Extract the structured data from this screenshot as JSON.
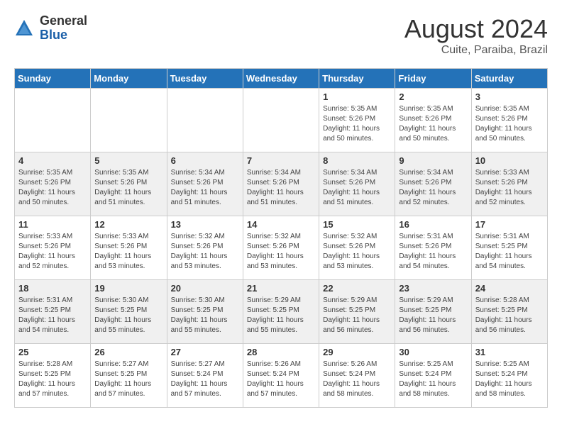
{
  "header": {
    "logo_general": "General",
    "logo_blue": "Blue",
    "month": "August 2024",
    "location": "Cuite, Paraiba, Brazil"
  },
  "weekdays": [
    "Sunday",
    "Monday",
    "Tuesday",
    "Wednesday",
    "Thursday",
    "Friday",
    "Saturday"
  ],
  "weeks": [
    [
      {
        "day": "",
        "info": ""
      },
      {
        "day": "",
        "info": ""
      },
      {
        "day": "",
        "info": ""
      },
      {
        "day": "",
        "info": ""
      },
      {
        "day": "1",
        "info": "Sunrise: 5:35 AM\nSunset: 5:26 PM\nDaylight: 11 hours and 50 minutes."
      },
      {
        "day": "2",
        "info": "Sunrise: 5:35 AM\nSunset: 5:26 PM\nDaylight: 11 hours and 50 minutes."
      },
      {
        "day": "3",
        "info": "Sunrise: 5:35 AM\nSunset: 5:26 PM\nDaylight: 11 hours and 50 minutes."
      }
    ],
    [
      {
        "day": "4",
        "info": "Sunrise: 5:35 AM\nSunset: 5:26 PM\nDaylight: 11 hours and 50 minutes."
      },
      {
        "day": "5",
        "info": "Sunrise: 5:35 AM\nSunset: 5:26 PM\nDaylight: 11 hours and 51 minutes."
      },
      {
        "day": "6",
        "info": "Sunrise: 5:34 AM\nSunset: 5:26 PM\nDaylight: 11 hours and 51 minutes."
      },
      {
        "day": "7",
        "info": "Sunrise: 5:34 AM\nSunset: 5:26 PM\nDaylight: 11 hours and 51 minutes."
      },
      {
        "day": "8",
        "info": "Sunrise: 5:34 AM\nSunset: 5:26 PM\nDaylight: 11 hours and 51 minutes."
      },
      {
        "day": "9",
        "info": "Sunrise: 5:34 AM\nSunset: 5:26 PM\nDaylight: 11 hours and 52 minutes."
      },
      {
        "day": "10",
        "info": "Sunrise: 5:33 AM\nSunset: 5:26 PM\nDaylight: 11 hours and 52 minutes."
      }
    ],
    [
      {
        "day": "11",
        "info": "Sunrise: 5:33 AM\nSunset: 5:26 PM\nDaylight: 11 hours and 52 minutes."
      },
      {
        "day": "12",
        "info": "Sunrise: 5:33 AM\nSunset: 5:26 PM\nDaylight: 11 hours and 53 minutes."
      },
      {
        "day": "13",
        "info": "Sunrise: 5:32 AM\nSunset: 5:26 PM\nDaylight: 11 hours and 53 minutes."
      },
      {
        "day": "14",
        "info": "Sunrise: 5:32 AM\nSunset: 5:26 PM\nDaylight: 11 hours and 53 minutes."
      },
      {
        "day": "15",
        "info": "Sunrise: 5:32 AM\nSunset: 5:26 PM\nDaylight: 11 hours and 53 minutes."
      },
      {
        "day": "16",
        "info": "Sunrise: 5:31 AM\nSunset: 5:26 PM\nDaylight: 11 hours and 54 minutes."
      },
      {
        "day": "17",
        "info": "Sunrise: 5:31 AM\nSunset: 5:25 PM\nDaylight: 11 hours and 54 minutes."
      }
    ],
    [
      {
        "day": "18",
        "info": "Sunrise: 5:31 AM\nSunset: 5:25 PM\nDaylight: 11 hours and 54 minutes."
      },
      {
        "day": "19",
        "info": "Sunrise: 5:30 AM\nSunset: 5:25 PM\nDaylight: 11 hours and 55 minutes."
      },
      {
        "day": "20",
        "info": "Sunrise: 5:30 AM\nSunset: 5:25 PM\nDaylight: 11 hours and 55 minutes."
      },
      {
        "day": "21",
        "info": "Sunrise: 5:29 AM\nSunset: 5:25 PM\nDaylight: 11 hours and 55 minutes."
      },
      {
        "day": "22",
        "info": "Sunrise: 5:29 AM\nSunset: 5:25 PM\nDaylight: 11 hours and 56 minutes."
      },
      {
        "day": "23",
        "info": "Sunrise: 5:29 AM\nSunset: 5:25 PM\nDaylight: 11 hours and 56 minutes."
      },
      {
        "day": "24",
        "info": "Sunrise: 5:28 AM\nSunset: 5:25 PM\nDaylight: 11 hours and 56 minutes."
      }
    ],
    [
      {
        "day": "25",
        "info": "Sunrise: 5:28 AM\nSunset: 5:25 PM\nDaylight: 11 hours and 57 minutes."
      },
      {
        "day": "26",
        "info": "Sunrise: 5:27 AM\nSunset: 5:25 PM\nDaylight: 11 hours and 57 minutes."
      },
      {
        "day": "27",
        "info": "Sunrise: 5:27 AM\nSunset: 5:24 PM\nDaylight: 11 hours and 57 minutes."
      },
      {
        "day": "28",
        "info": "Sunrise: 5:26 AM\nSunset: 5:24 PM\nDaylight: 11 hours and 57 minutes."
      },
      {
        "day": "29",
        "info": "Sunrise: 5:26 AM\nSunset: 5:24 PM\nDaylight: 11 hours and 58 minutes."
      },
      {
        "day": "30",
        "info": "Sunrise: 5:25 AM\nSunset: 5:24 PM\nDaylight: 11 hours and 58 minutes."
      },
      {
        "day": "31",
        "info": "Sunrise: 5:25 AM\nSunset: 5:24 PM\nDaylight: 11 hours and 58 minutes."
      }
    ]
  ]
}
